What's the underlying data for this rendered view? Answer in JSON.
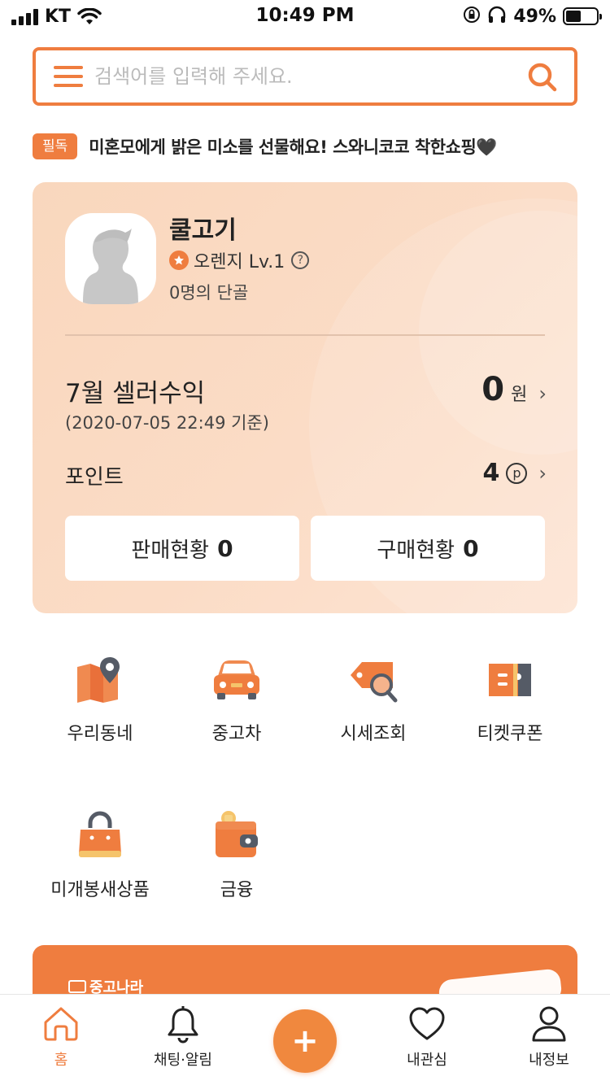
{
  "status_bar": {
    "carrier": "KT",
    "time": "10:49 PM",
    "battery_percent": "49%",
    "battery_level": 0.49
  },
  "search": {
    "placeholder": "검색어를 입력해 주세요.",
    "value": ""
  },
  "notice": {
    "badge": "필독",
    "text": "미혼모에게 밝은 미소를 선물해요! 스와니코코 착한쇼핑🖤"
  },
  "profile": {
    "nickname": "쿨고기",
    "grade": "오렌지 Lv.1",
    "help_glyph": "?",
    "regulars": "0명의 단골",
    "earnings_label": "7월 셀러수익",
    "earnings_date": "(2020-07-05 22:49 기준)",
    "earnings_value": "0",
    "earnings_unit": "원",
    "point_label": "포인트",
    "point_value": "4",
    "point_unit": "p",
    "sales_label": "판매현황",
    "sales_count": "0",
    "purchase_label": "구매현황",
    "purchase_count": "0",
    "chevron": "›"
  },
  "menu": {
    "items": [
      {
        "label": "우리동네",
        "icon": "map-pin-icon"
      },
      {
        "label": "중고차",
        "icon": "car-icon"
      },
      {
        "label": "시세조회",
        "icon": "price-tag-search-icon"
      },
      {
        "label": "티켓쿠폰",
        "icon": "ticket-icon"
      },
      {
        "label": "미개봉새상품",
        "icon": "shopping-bag-icon"
      },
      {
        "label": "금융",
        "icon": "wallet-icon"
      }
    ]
  },
  "banner": {
    "logo_text": "중고나라"
  },
  "bottom_nav": {
    "home": "홈",
    "chat": "채팅·알림",
    "add": "+",
    "wishlist": "내관심",
    "myinfo": "내정보"
  },
  "colors": {
    "accent": "#ef7d3f",
    "card_bg": "#f9d7bd",
    "text": "#222222"
  }
}
